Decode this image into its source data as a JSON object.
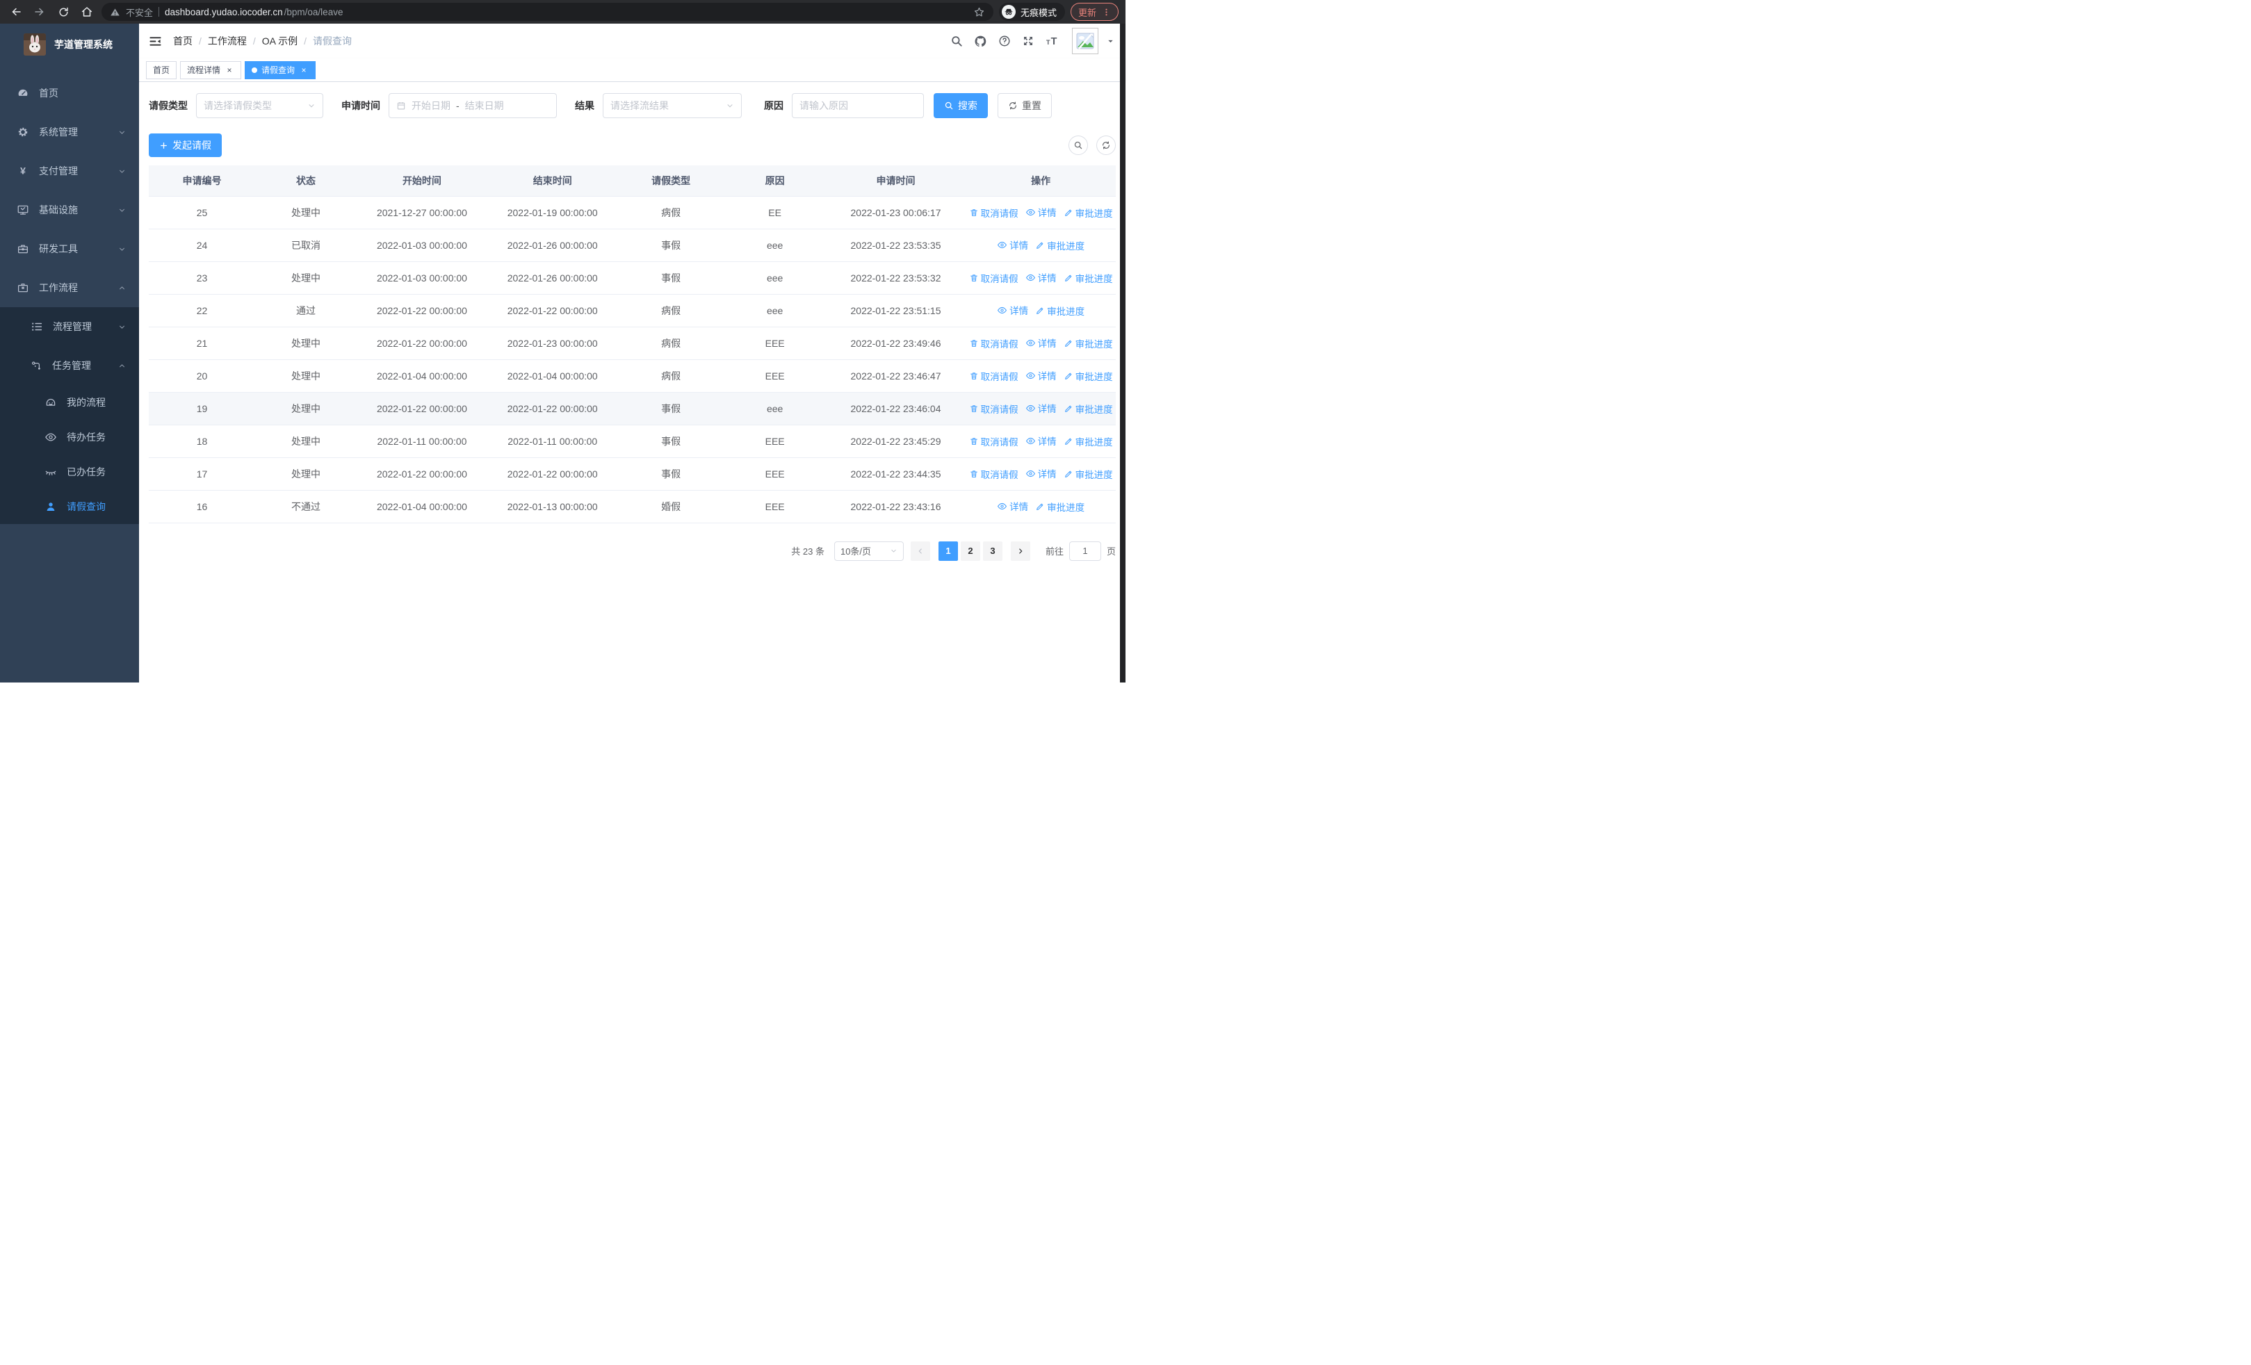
{
  "browser": {
    "security_label": "不安全",
    "url_host": "dashboard.yudao.iocoder.cn",
    "url_path": "/bpm/oa/leave",
    "incognito_label": "无痕模式",
    "update_label": "更新"
  },
  "colors": {
    "accent": "#409eff",
    "sidebar_bg": "#304156",
    "sidebar_submenu_bg": "#1f2d3d",
    "sidebar_text": "#bfcbd9",
    "update_accent": "#e8837b"
  },
  "sidebar": {
    "app_title": "芋道管理系统",
    "items": [
      {
        "key": "home",
        "label": "首页",
        "icon": "dashboard-icon",
        "level": 1
      },
      {
        "key": "system",
        "label": "系统管理",
        "icon": "gear-icon",
        "level": 1,
        "chevron": "down"
      },
      {
        "key": "payment",
        "label": "支付管理",
        "icon": "yen-icon",
        "level": 1,
        "chevron": "down"
      },
      {
        "key": "infra",
        "label": "基础设施",
        "icon": "monitor-icon",
        "level": 1,
        "chevron": "down"
      },
      {
        "key": "devtools",
        "label": "研发工具",
        "icon": "toolbox-icon",
        "level": 1,
        "chevron": "down"
      },
      {
        "key": "workflow",
        "label": "工作流程",
        "icon": "briefcase-icon",
        "level": 1,
        "chevron": "up"
      },
      {
        "key": "process-mgmt",
        "label": "流程管理",
        "icon": "list-icon",
        "level": 2,
        "chevron": "down"
      },
      {
        "key": "task-mgmt",
        "label": "任务管理",
        "icon": "flow-icon",
        "level": 2,
        "chevron": "up"
      },
      {
        "key": "my-process",
        "label": "我的流程",
        "icon": "robot-icon",
        "level": 3
      },
      {
        "key": "todo-task",
        "label": "待办任务",
        "icon": "eye-icon",
        "level": 3
      },
      {
        "key": "done-task",
        "label": "已办任务",
        "icon": "eye-closed-icon",
        "level": 3
      },
      {
        "key": "leave-query",
        "label": "请假查询",
        "icon": "user-icon",
        "level": 3,
        "active": true
      }
    ]
  },
  "header": {
    "breadcrumb": [
      "首页",
      "工作流程",
      "OA 示例",
      "请假查询"
    ]
  },
  "tabs": [
    {
      "label": "首页",
      "closable": false,
      "active": false
    },
    {
      "label": "流程详情",
      "closable": true,
      "active": false
    },
    {
      "label": "请假查询",
      "closable": true,
      "active": true
    }
  ],
  "filters": {
    "type_label": "请假类型",
    "type_placeholder": "请选择请假类型",
    "time_label": "申请时间",
    "start_placeholder": "开始日期",
    "range_separator": "-",
    "end_placeholder": "结束日期",
    "result_label": "结果",
    "result_placeholder": "请选择流结果",
    "reason_label": "原因",
    "reason_placeholder": "请输入原因",
    "search_label": "搜索",
    "reset_label": "重置"
  },
  "toolbar": {
    "create_label": "发起请假"
  },
  "table": {
    "columns": [
      "申请编号",
      "状态",
      "开始时间",
      "结束时间",
      "请假类型",
      "原因",
      "申请时间",
      "操作"
    ],
    "action_labels": {
      "cancel": "取消请假",
      "detail": "详情",
      "progress": "审批进度"
    },
    "rows": [
      {
        "id": "25",
        "status": "处理中",
        "start_time": "2021-12-27 00:00:00",
        "end_time": "2022-01-19 00:00:00",
        "type": "病假",
        "reason": "EE",
        "apply_time": "2022-01-23 00:06:17",
        "actions": [
          "cancel",
          "detail",
          "progress"
        ]
      },
      {
        "id": "24",
        "status": "已取消",
        "start_time": "2022-01-03 00:00:00",
        "end_time": "2022-01-26 00:00:00",
        "type": "事假",
        "reason": "eee",
        "apply_time": "2022-01-22 23:53:35",
        "actions": [
          "detail",
          "progress"
        ]
      },
      {
        "id": "23",
        "status": "处理中",
        "start_time": "2022-01-03 00:00:00",
        "end_time": "2022-01-26 00:00:00",
        "type": "事假",
        "reason": "eee",
        "apply_time": "2022-01-22 23:53:32",
        "actions": [
          "cancel",
          "detail",
          "progress"
        ]
      },
      {
        "id": "22",
        "status": "通过",
        "start_time": "2022-01-22 00:00:00",
        "end_time": "2022-01-22 00:00:00",
        "type": "病假",
        "reason": "eee",
        "apply_time": "2022-01-22 23:51:15",
        "actions": [
          "detail",
          "progress"
        ]
      },
      {
        "id": "21",
        "status": "处理中",
        "start_time": "2022-01-22 00:00:00",
        "end_time": "2022-01-23 00:00:00",
        "type": "病假",
        "reason": "EEE",
        "apply_time": "2022-01-22 23:49:46",
        "actions": [
          "cancel",
          "detail",
          "progress"
        ]
      },
      {
        "id": "20",
        "status": "处理中",
        "start_time": "2022-01-04 00:00:00",
        "end_time": "2022-01-04 00:00:00",
        "type": "病假",
        "reason": "EEE",
        "apply_time": "2022-01-22 23:46:47",
        "actions": [
          "cancel",
          "detail",
          "progress"
        ]
      },
      {
        "id": "19",
        "status": "处理中",
        "start_time": "2022-01-22 00:00:00",
        "end_time": "2022-01-22 00:00:00",
        "type": "事假",
        "reason": "eee",
        "apply_time": "2022-01-22 23:46:04",
        "actions": [
          "cancel",
          "detail",
          "progress"
        ],
        "hover": true
      },
      {
        "id": "18",
        "status": "处理中",
        "start_time": "2022-01-11 00:00:00",
        "end_time": "2022-01-11 00:00:00",
        "type": "事假",
        "reason": "EEE",
        "apply_time": "2022-01-22 23:45:29",
        "actions": [
          "cancel",
          "detail",
          "progress"
        ]
      },
      {
        "id": "17",
        "status": "处理中",
        "start_time": "2022-01-22 00:00:00",
        "end_time": "2022-01-22 00:00:00",
        "type": "事假",
        "reason": "EEE",
        "apply_time": "2022-01-22 23:44:35",
        "actions": [
          "cancel",
          "detail",
          "progress"
        ]
      },
      {
        "id": "16",
        "status": "不通过",
        "start_time": "2022-01-04 00:00:00",
        "end_time": "2022-01-13 00:00:00",
        "type": "婚假",
        "reason": "EEE",
        "apply_time": "2022-01-22 23:43:16",
        "actions": [
          "detail",
          "progress"
        ]
      }
    ]
  },
  "pagination": {
    "total_label": "共 23 条",
    "page_size_label": "10条/页",
    "pages": [
      "1",
      "2",
      "3"
    ],
    "active_page": "1",
    "goto_label": "前往",
    "goto_value": "1",
    "page_unit_label": "页"
  }
}
